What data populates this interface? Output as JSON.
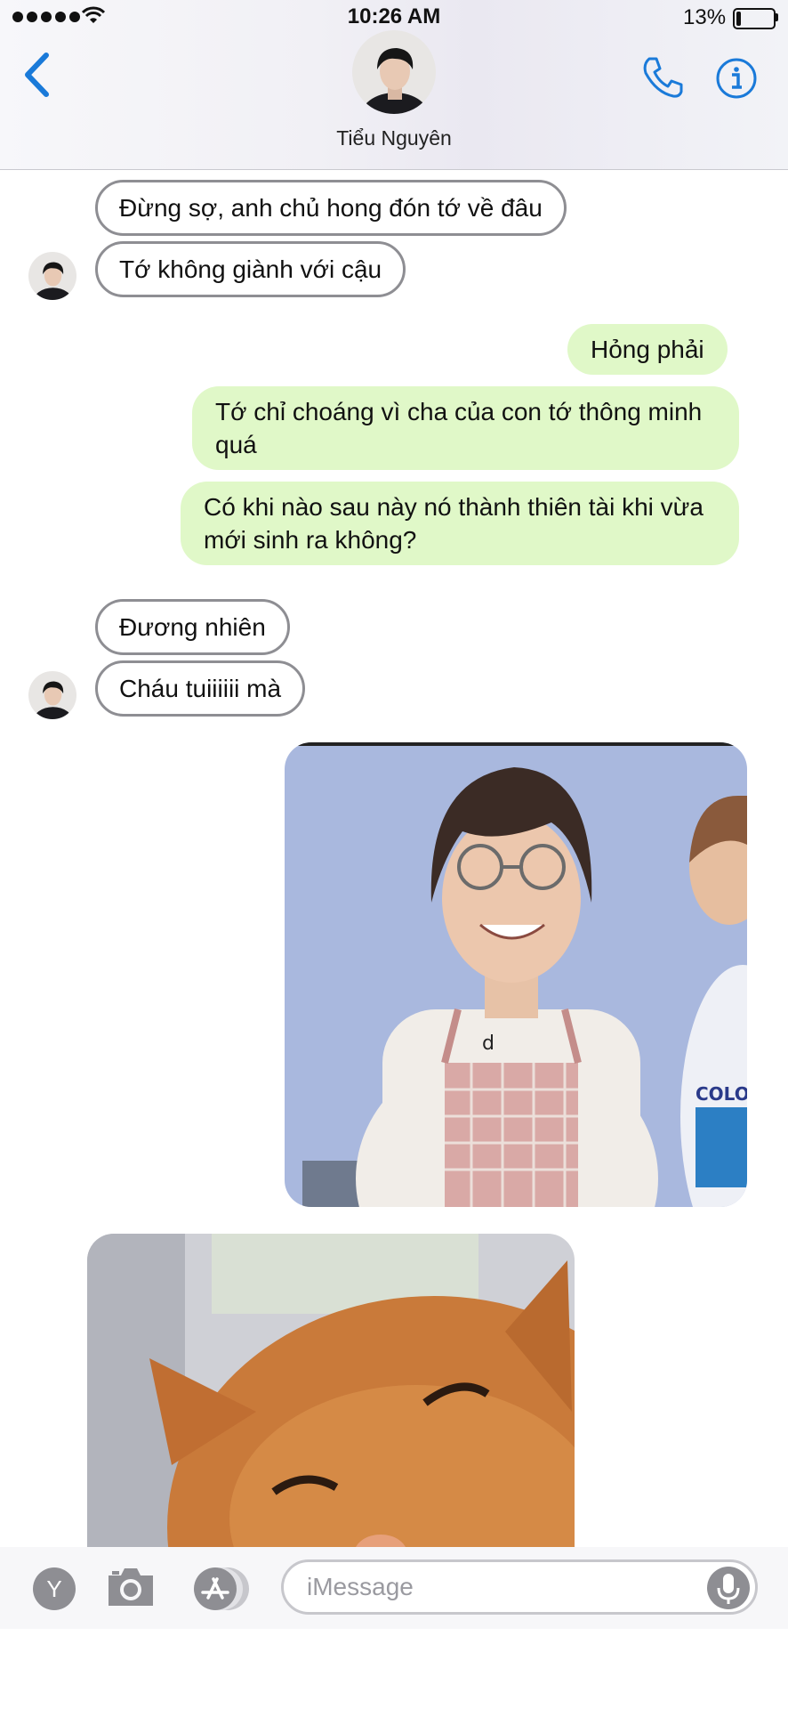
{
  "status_bar": {
    "time": "10:26 AM",
    "battery_percent_label": "13%",
    "battery_level": 0.13
  },
  "header": {
    "contact_name": "Tiểu Nguyên"
  },
  "messages": [
    {
      "direction": "incoming",
      "text": "Đừng sợ, anh chủ hong đón tớ về đâu"
    },
    {
      "direction": "incoming",
      "text": "Tớ không giành với cậu"
    },
    {
      "direction": "outgoing",
      "text": "Hỏng phải"
    },
    {
      "direction": "outgoing",
      "text": "Tớ chỉ choáng vì cha của con tớ thông minh quá"
    },
    {
      "direction": "outgoing",
      "text": "Có khi nào sau này nó thành thiên tài khi vừa mới sinh ra không?"
    },
    {
      "direction": "incoming",
      "text": "Đương nhiên"
    },
    {
      "direction": "incoming",
      "text": "Cháu tuiiiiii mà"
    }
  ],
  "photo_messages": [
    {
      "direction": "outgoing",
      "subject": "smiling boy with glasses and checkered apron",
      "shirt_text": "COLO"
    },
    {
      "direction": "incoming",
      "subject": "orange cat squinting"
    }
  ],
  "input_bar": {
    "app_button_letter": "Y",
    "placeholder": "iMessage"
  },
  "colors": {
    "accent": "#1a7ad9",
    "outgoing_bubble": "#e0f8c8",
    "incoming_border": "#8e8e93"
  },
  "icons": [
    "back-chevron-icon",
    "phone-icon",
    "info-icon",
    "camera-icon",
    "app-store-icon",
    "microphone-icon",
    "wifi-icon"
  ]
}
